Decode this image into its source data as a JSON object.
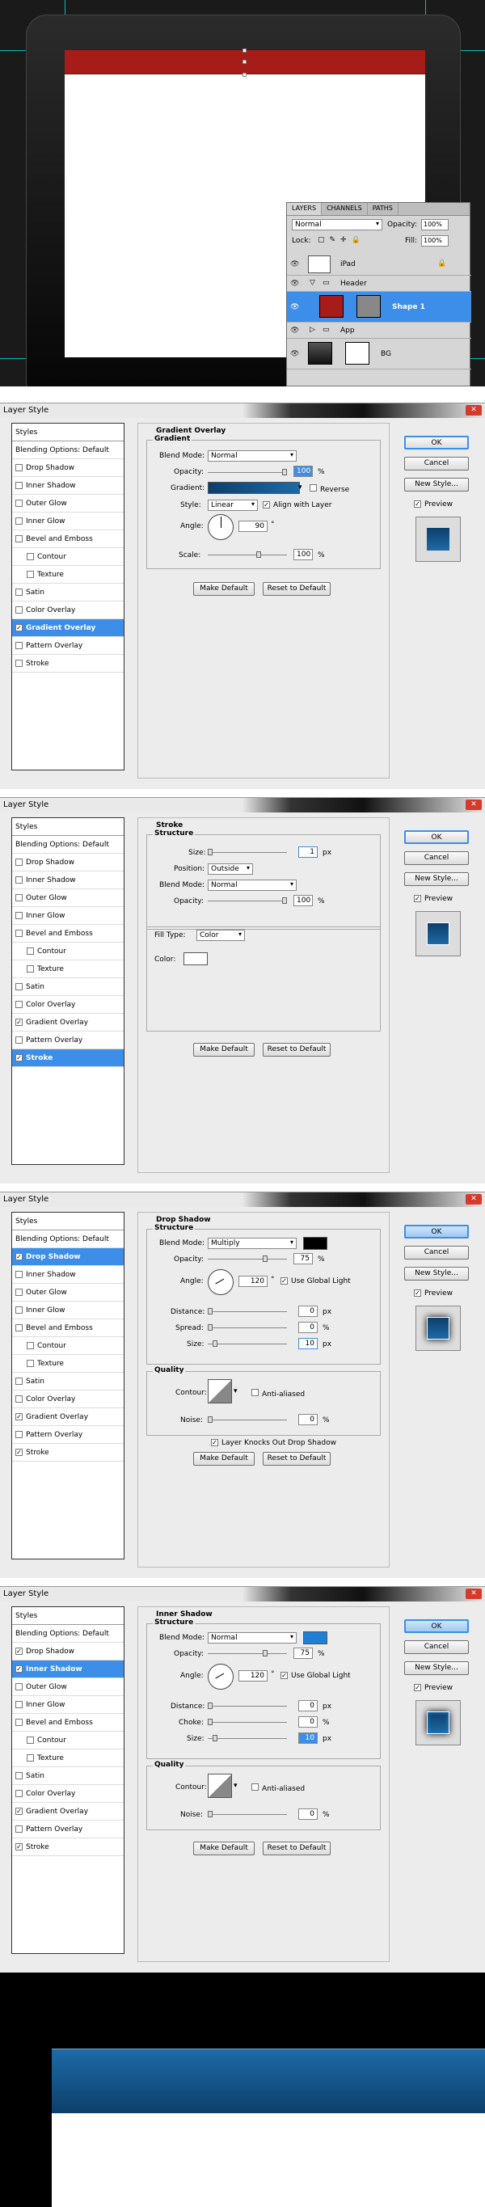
{
  "layers_panel": {
    "tabs": [
      "LAYERS",
      "CHANNELS",
      "PATHS"
    ],
    "blend_mode": "Normal",
    "opacity_label": "Opacity:",
    "opacity_value": "100%",
    "lock_label": "Lock:",
    "fill_label": "Fill:",
    "fill_value": "100%",
    "layers": [
      "iPad",
      "Header",
      "Shape 1",
      "App",
      "BG"
    ]
  },
  "dialog_title": "Layer Style",
  "buttons": {
    "ok": "OK",
    "cancel": "Cancel",
    "new_style": "New Style...",
    "preview": "Preview",
    "make_default": "Make Default",
    "reset_to_default": "Reset to Default"
  },
  "styles_list": {
    "header": "Styles",
    "blending": "Blending Options: Default",
    "items": [
      "Drop Shadow",
      "Inner Shadow",
      "Outer Glow",
      "Inner Glow",
      "Bevel and Emboss",
      "Contour",
      "Texture",
      "Satin",
      "Color Overlay",
      "Gradient Overlay",
      "Pattern Overlay",
      "Stroke"
    ]
  },
  "gradient_overlay": {
    "title": "Gradient Overlay",
    "section": "Gradient",
    "blend_mode_label": "Blend Mode:",
    "blend_mode": "Normal",
    "opacity_label": "Opacity:",
    "opacity": "100",
    "pct": "%",
    "gradient_label": "Gradient:",
    "reverse": "Reverse",
    "style_label": "Style:",
    "style": "Linear",
    "align": "Align with Layer",
    "angle_label": "Angle:",
    "angle": "90",
    "deg": "°",
    "scale_label": "Scale:",
    "scale": "100"
  },
  "stroke": {
    "title": "Stroke",
    "section": "Structure",
    "size_label": "Size:",
    "size": "1",
    "px": "px",
    "position_label": "Position:",
    "position": "Outside",
    "blend_mode_label": "Blend Mode:",
    "blend_mode": "Normal",
    "opacity_label": "Opacity:",
    "opacity": "100",
    "pct": "%",
    "fill_type_label": "Fill Type:",
    "fill_type": "Color",
    "color_label": "Color:"
  },
  "drop_shadow": {
    "title": "Drop Shadow",
    "section": "Structure",
    "blend_mode_label": "Blend Mode:",
    "blend_mode": "Multiply",
    "opacity_label": "Opacity:",
    "opacity": "75",
    "pct": "%",
    "angle_label": "Angle:",
    "angle": "120",
    "deg": "°",
    "global_light": "Use Global Light",
    "distance_label": "Distance:",
    "distance": "0",
    "spread_label": "Spread:",
    "spread": "0",
    "size_label": "Size:",
    "size": "10",
    "px": "px",
    "quality": "Quality",
    "contour_label": "Contour:",
    "anti_aliased": "Anti-aliased",
    "noise_label": "Noise:",
    "noise": "0",
    "knocks_out": "Layer Knocks Out Drop Shadow"
  },
  "inner_shadow": {
    "title": "Inner Shadow",
    "section": "Structure",
    "blend_mode_label": "Blend Mode:",
    "blend_mode": "Normal",
    "opacity_label": "Opacity:",
    "opacity": "75",
    "pct": "%",
    "angle_label": "Angle:",
    "angle": "120",
    "deg": "°",
    "global_light": "Use Global Light",
    "distance_label": "Distance:",
    "distance": "0",
    "choke_label": "Choke:",
    "choke": "0",
    "size_label": "Size:",
    "size": "10",
    "px": "px",
    "quality": "Quality",
    "contour_label": "Contour:",
    "anti_aliased": "Anti-aliased",
    "noise_label": "Noise:",
    "noise": "0"
  },
  "colors": {
    "header_red": "#a51c19",
    "accent_blue": "#3d8ee8",
    "gradient_dark": "#0d3f6b",
    "gradient_light": "#1e6aa6"
  }
}
